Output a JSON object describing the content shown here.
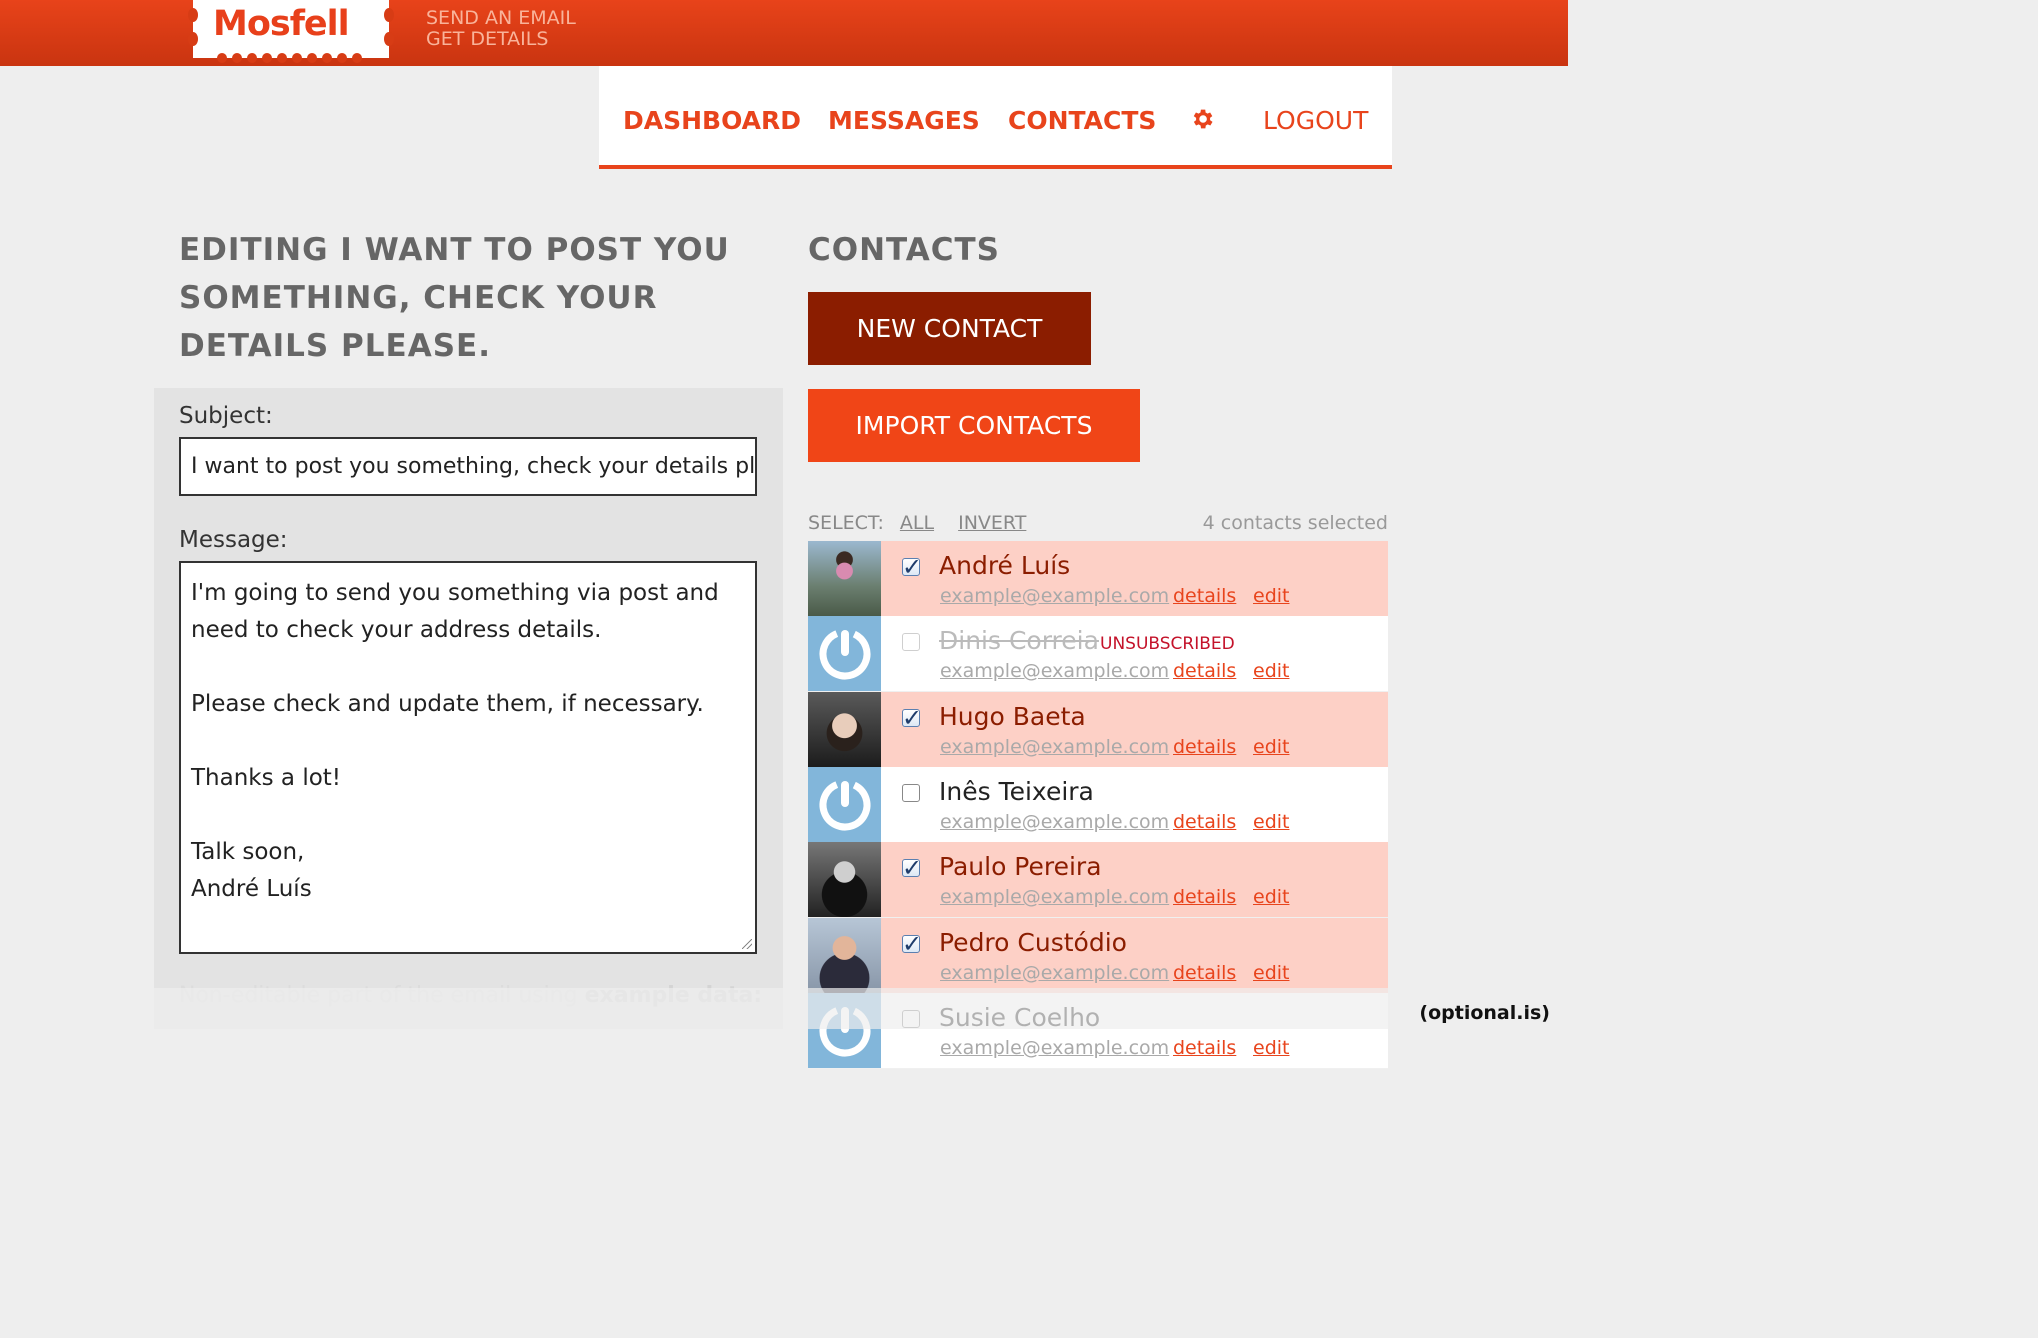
{
  "header": {
    "logo": "Mosfell",
    "tagline": [
      "SEND AN EMAIL",
      "GET DETAILS"
    ]
  },
  "nav": {
    "dashboard": "DASHBOARD",
    "messages": "MESSAGES",
    "contacts": "CONTACTS",
    "logout": "LOGOUT"
  },
  "editor": {
    "title": "EDITING I WANT TO POST YOU SOMETHING, CHECK YOUR DETAILS PLEASE.",
    "subject_label": "Subject:",
    "subject_value": "I want to post you something, check your details please.",
    "message_label": "Message:",
    "message_lines": [
      "I'm going to send you something via post and need to check your address details.",
      "Please check and update them, if necessary.",
      "Thanks a lot!",
      "Talk soon,",
      "André Luís"
    ],
    "noneditable_text": "Non-editable part of the email using ",
    "noneditable_bold": "example data:"
  },
  "contacts": {
    "title": "CONTACTS",
    "new_button": "NEW CONTACT",
    "import_button": "IMPORT CONTACTS",
    "select_label": "SELECT:",
    "select_all": "ALL",
    "select_invert": "INVERT",
    "selected_count": "4 contacts selected",
    "details_label": "details",
    "edit_label": "edit",
    "unsubscribed_label": "UNSUBSCRIBED",
    "rows": [
      {
        "name": "André Luís",
        "email": "example@example.com",
        "checked": true,
        "avatar": "photo-andre"
      },
      {
        "name": "Dinis Correia",
        "email": "example@example.com",
        "checked": false,
        "unsubscribed": true,
        "avatar": "default-power-icon"
      },
      {
        "name": "Hugo Baeta",
        "email": "example@example.com",
        "checked": true,
        "avatar": "photo-hugo"
      },
      {
        "name": "Inês Teixeira",
        "email": "example@example.com",
        "checked": false,
        "avatar": "default-power-icon"
      },
      {
        "name": "Paulo Pereira",
        "email": "example@example.com",
        "checked": true,
        "avatar": "photo-paulo"
      },
      {
        "name": "Pedro Custódio",
        "email": "example@example.com",
        "checked": true,
        "avatar": "photo-pedro"
      },
      {
        "name": "Susie Coelho",
        "email": "example@example.com",
        "checked": false,
        "avatar": "default-power-icon"
      }
    ]
  },
  "footer": {
    "brand": "(optional.is)"
  },
  "colors": {
    "accent": "#e8441c",
    "dark_accent": "#8b1d00",
    "selected_row": "#fdd0c6"
  }
}
